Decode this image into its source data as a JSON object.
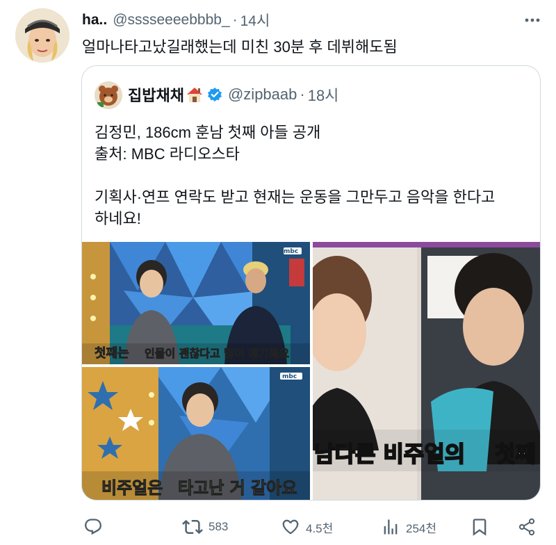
{
  "tweet": {
    "name": "ha..",
    "handle": "@sssseeeebbbb_",
    "separator": "·",
    "time": "14시",
    "text": "얼마나타고났길래했는데 미친 30분 후 데뷔해도됨"
  },
  "quoted": {
    "name": "집밥채채",
    "handle": "@zipbaab",
    "separator": "·",
    "time": "18시",
    "lines": [
      "김정민, 186cm 훈남 첫째 아들 공개",
      "출처: MBC 라디오스타",
      "",
      "기획사·연프 연락도 받고 현재는 운동을 그만두고 음악을 한다고",
      "하네요!"
    ],
    "media": {
      "top_left_caption_a": "첫째는",
      "top_left_caption_b": "인물이 괜찮다고 많이 얘기해요",
      "bottom_left_caption_a": "비주얼은",
      "bottom_left_caption_b": "타고난 거 같아요",
      "right_caption_a": "남다른 비주얼의",
      "right_caption_b": "첫째",
      "broadcaster_logo": "mbc"
    }
  },
  "actions": {
    "reply_count": "",
    "retweet_count": "583",
    "like_count": "4.5천",
    "views_count": "254천"
  },
  "colors": {
    "text": "#0f1419",
    "secondary": "#536471",
    "border": "#cfd9de",
    "verified": "#1d9bf0"
  }
}
